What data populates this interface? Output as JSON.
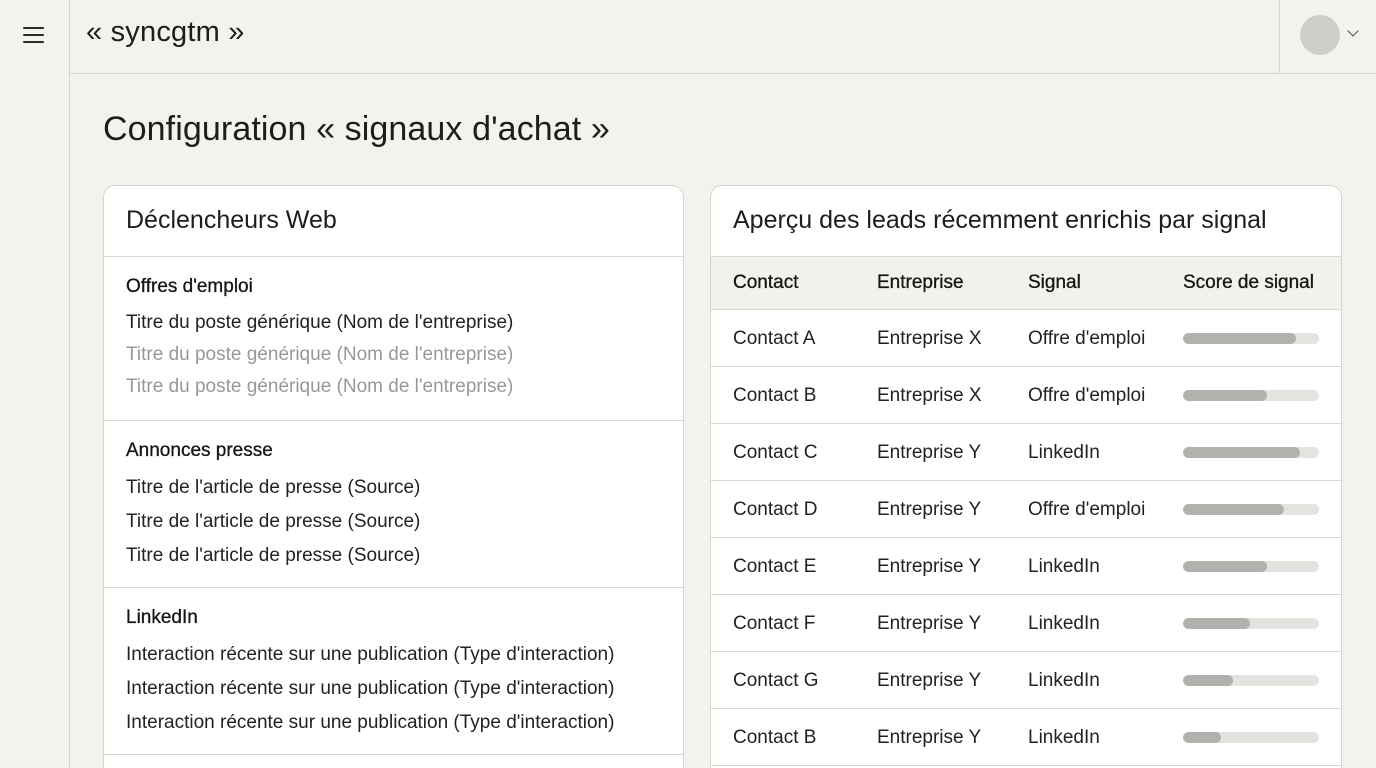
{
  "app": {
    "brand": "« syncgtm »"
  },
  "icons": {
    "menu": "hamburger-menu-icon",
    "avatar": "user-avatar",
    "dropdown": "chevron-down-icon"
  },
  "page": {
    "title": "Configuration « signaux d'achat »"
  },
  "triggers": {
    "title": "Déclencheurs Web",
    "sections": [
      {
        "title": "Offres d'emploi",
        "items": [
          {
            "text": "Titre du poste générique (Nom de l'entreprise)",
            "muted": false
          },
          {
            "text": "Titre du poste générique (Nom de l'entreprise)",
            "muted": true
          },
          {
            "text": "Titre du poste générique (Nom de l'entreprise)",
            "muted": true
          }
        ]
      },
      {
        "title": "Annonces presse",
        "items": [
          {
            "text": "Titre de l'article de presse (Source)",
            "muted": false
          },
          {
            "text": "Titre de l'article de presse (Source)",
            "muted": false
          },
          {
            "text": "Titre de l'article de presse (Source)",
            "muted": false
          }
        ]
      },
      {
        "title": "LinkedIn",
        "items": [
          {
            "text": "Interaction récente sur une publication (Type d'interaction)",
            "muted": false
          },
          {
            "text": "Interaction récente sur une publication (Type d'interaction)",
            "muted": false
          },
          {
            "text": "Interaction récente sur une publication (Type d'interaction)",
            "muted": false
          }
        ]
      }
    ]
  },
  "leads": {
    "title": "Aperçu des leads récemment enrichis par signal",
    "columns": [
      "Contact",
      "Entreprise",
      "Signal",
      "Score de signal"
    ],
    "rows": [
      {
        "contact": "Contact A",
        "company": "Entreprise X",
        "signal": "Offre d'emploi",
        "score": 0.83
      },
      {
        "contact": "Contact B",
        "company": "Entreprise X",
        "signal": "Offre d'emploi",
        "score": 0.62
      },
      {
        "contact": "Contact C",
        "company": "Entreprise Y",
        "signal": "LinkedIn",
        "score": 0.86
      },
      {
        "contact": "Contact D",
        "company": "Entreprise Y",
        "signal": "Offre d'emploi",
        "score": 0.74
      },
      {
        "contact": "Contact E",
        "company": "Entreprise Y",
        "signal": "LinkedIn",
        "score": 0.62
      },
      {
        "contact": "Contact F",
        "company": "Entreprise Y",
        "signal": "LinkedIn",
        "score": 0.49
      },
      {
        "contact": "Contact G",
        "company": "Entreprise Y",
        "signal": "LinkedIn",
        "score": 0.37
      },
      {
        "contact": "Contact B",
        "company": "Entreprise Y",
        "signal": "LinkedIn",
        "score": 0.28
      }
    ]
  }
}
